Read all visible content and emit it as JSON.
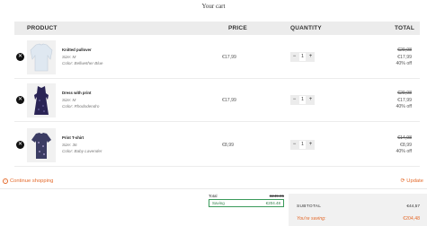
{
  "page": {
    "title": "Your cart"
  },
  "table": {
    "headers": {
      "product": "PRODUCT",
      "price": "PRICE",
      "quantity": "QUANTITY",
      "total": "TOTAL"
    }
  },
  "items": [
    {
      "name": "Knitted pullover",
      "size": "Size: M",
      "color": "Color: Bellwether Blue",
      "price": "€17,99",
      "qty": "1",
      "total_original": "€29,98",
      "total": "€17,99",
      "discount": "40% off",
      "thumb_color": "#dfe8f1"
    },
    {
      "name": "Dress with print",
      "size": "Size: M",
      "color": "Color: Rhododendro",
      "price": "€17,99",
      "qty": "1",
      "total_original": "€29,98",
      "total": "€17,99",
      "discount": "40% off",
      "thumb_color": "#2a2455"
    },
    {
      "name": "Print T-shirt",
      "size": "Size: 36",
      "color": "Color: Baby Lavender",
      "price": "€8,99",
      "qty": "1",
      "total_original": "€14,98",
      "total": "€8,99",
      "discount": "40% off",
      "thumb_color": "#3b3c63"
    }
  ],
  "actions": {
    "continue": "Continue shopping",
    "update": "Update"
  },
  "summary": {
    "total_label": "Total",
    "total_value": "€249.05",
    "saving_label": "Saving",
    "saving_value": "€204.48",
    "subtotal_label": "SUBTOTAL",
    "subtotal_value": "€44,57",
    "you_saving_label": "You're saving:",
    "you_saving_value": "€204,48"
  },
  "colors": {
    "accent": "#e46a2b",
    "saving_green": "#2f7d47",
    "header_bg": "#ececec"
  },
  "icons": {
    "remove": "close-icon",
    "continue": "arrow-left-circle-icon",
    "update": "refresh-icon"
  }
}
